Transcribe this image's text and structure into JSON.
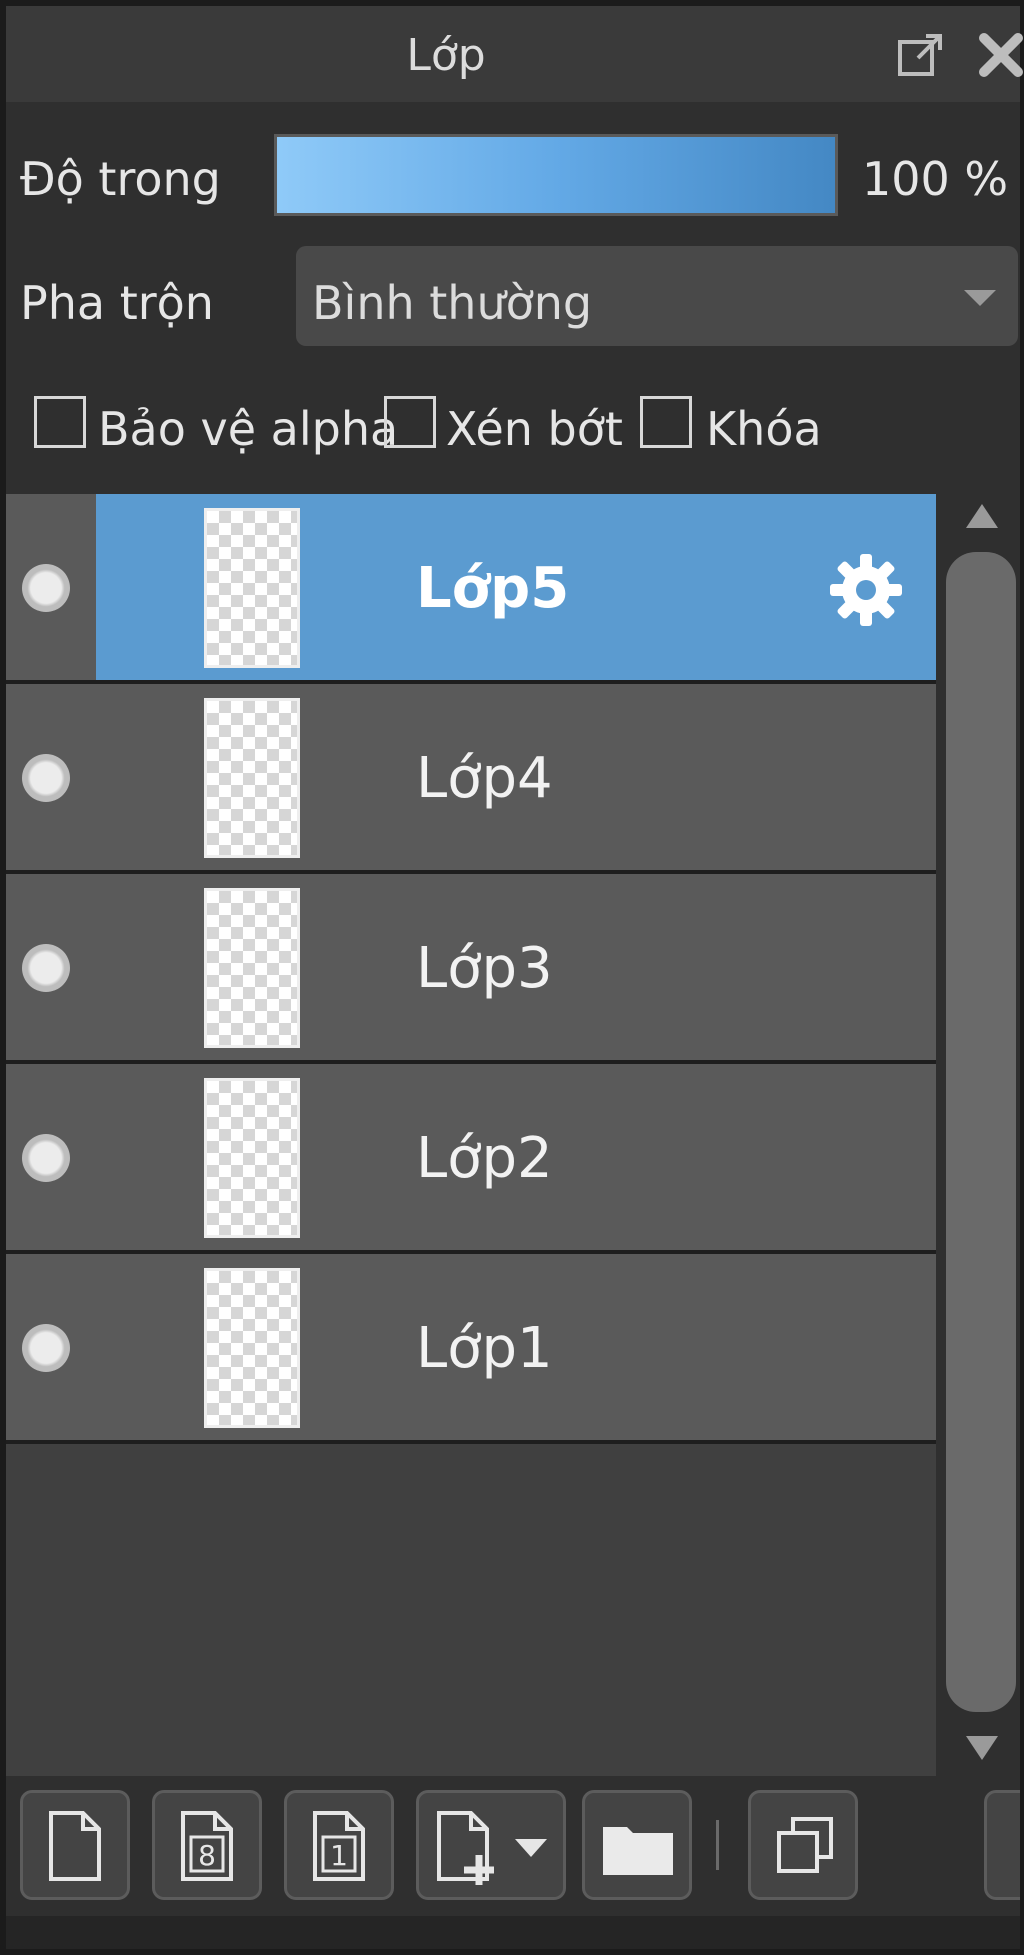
{
  "panel": {
    "title": "Lớp"
  },
  "opacity": {
    "label": "Độ trong",
    "value_text": "100 %",
    "value": 100,
    "bar_color_start": "#8fcaf8",
    "bar_color_end": "#4488c4"
  },
  "blend": {
    "label": "Pha trộn",
    "selected": "Bình thường"
  },
  "options": {
    "protect_alpha": {
      "label": "Bảo vệ alpha",
      "checked": false
    },
    "clipping": {
      "label": "Xén bớt",
      "checked": false
    },
    "lock": {
      "label": "Khóa",
      "checked": false
    }
  },
  "layers": [
    {
      "name": "Lớp5",
      "selected": true
    },
    {
      "name": "Lớp4",
      "selected": false
    },
    {
      "name": "Lớp3",
      "selected": false
    },
    {
      "name": "Lớp2",
      "selected": false
    },
    {
      "name": "Lớp1",
      "selected": false
    }
  ],
  "colors": {
    "selected_layer": "#5b9bd0",
    "layer_bg": "#5a5a5a",
    "panel_bg": "#2f2f2f"
  },
  "toolbar": {
    "icons": [
      "new-layer-icon",
      "new-8bit-layer-icon",
      "new-1bit-layer-icon",
      "add-layer-menu-icon",
      "new-folder-icon",
      "duplicate-layer-icon"
    ]
  }
}
